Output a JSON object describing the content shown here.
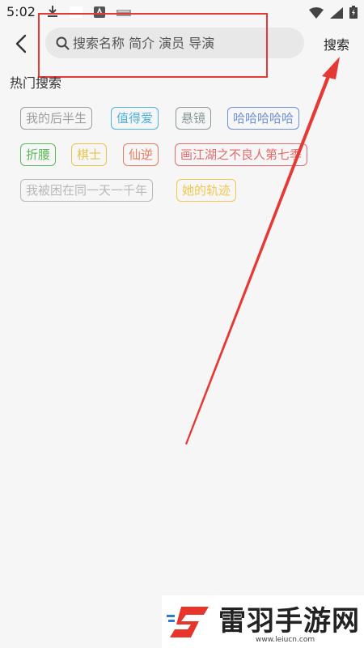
{
  "status_bar": {
    "time": "5:02"
  },
  "header": {
    "search_placeholder": "搜索名称 简介 演员 导演",
    "search_value": "",
    "submit_label": "搜索"
  },
  "hot_search": {
    "title": "热门搜索",
    "tags": [
      {
        "label": "我的后半生",
        "color": "#9e9e9e"
      },
      {
        "label": "值得爱",
        "color": "#4fb3e0"
      },
      {
        "label": "悬镜",
        "color": "#8a9a9a"
      },
      {
        "label": "哈哈哈哈哈",
        "color": "#6f8fd6"
      },
      {
        "label": "折腰",
        "color": "#5cb85c"
      },
      {
        "label": "棋士",
        "color": "#e6c34a"
      },
      {
        "label": "仙逆",
        "color": "#e87a5d"
      },
      {
        "label": "画江湖之不良人第七季",
        "color": "#e26b6b"
      },
      {
        "label": "我被困在同一天一千年",
        "color": "#b8b8b8"
      },
      {
        "label": "她的轨迹",
        "color": "#f0c850"
      }
    ]
  },
  "watermark": {
    "title": "雷羽手游网",
    "url": "www.leiucn.com"
  },
  "colors": {
    "annotation": "#e53935"
  }
}
